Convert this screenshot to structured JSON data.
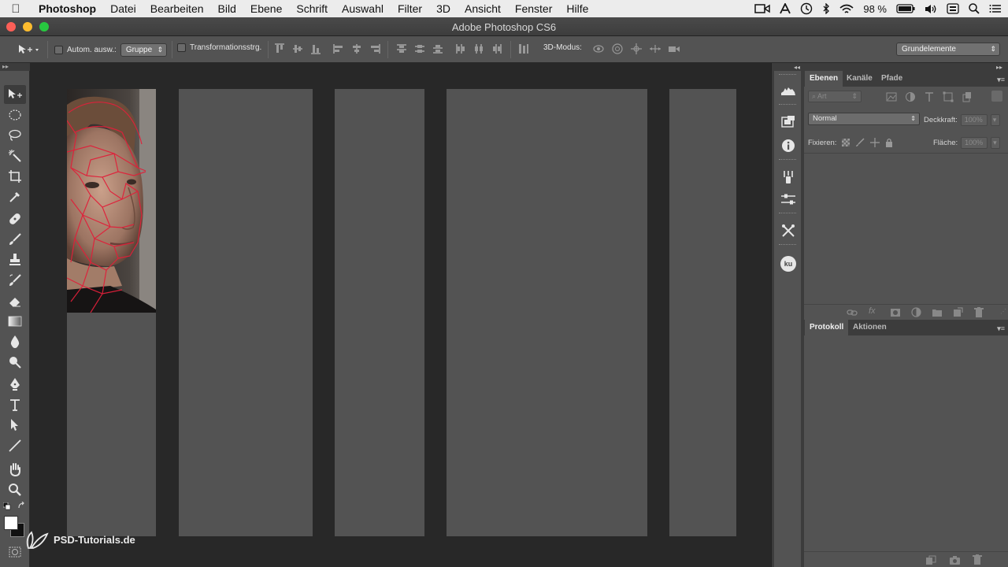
{
  "menubar": {
    "app_name": "Photoshop",
    "items": [
      "Datei",
      "Bearbeiten",
      "Bild",
      "Ebene",
      "Schrift",
      "Auswahl",
      "Filter",
      "3D",
      "Ansicht",
      "Fenster",
      "Hilfe"
    ],
    "battery": "98 %"
  },
  "window": {
    "title": "Adobe Photoshop CS6"
  },
  "options": {
    "auto_select_label": "Autom. ausw.:",
    "auto_select_value": "Gruppe",
    "transform_label": "Transformationsstrg.",
    "mode_3d_label": "3D-Modus:",
    "workspace_value": "Grundelemente"
  },
  "layers_panel": {
    "tabs": [
      "Ebenen",
      "Kanäle",
      "Pfade"
    ],
    "filter_placeholder": "Art",
    "blend_mode": "Normal",
    "opacity_label": "Deckkraft:",
    "opacity_value": "100%",
    "lock_label": "Fixieren:",
    "fill_label": "Fläche:",
    "fill_value": "100%"
  },
  "history_panel": {
    "tabs": [
      "Protokoll",
      "Aktionen"
    ]
  },
  "dock": {
    "ku_label": "ku"
  },
  "watermark": {
    "text": "PSD-Tutorials.de"
  },
  "colors": {
    "ui_dark": "#282828",
    "ui_panel": "#535353",
    "wireframe": "#e0203a"
  }
}
